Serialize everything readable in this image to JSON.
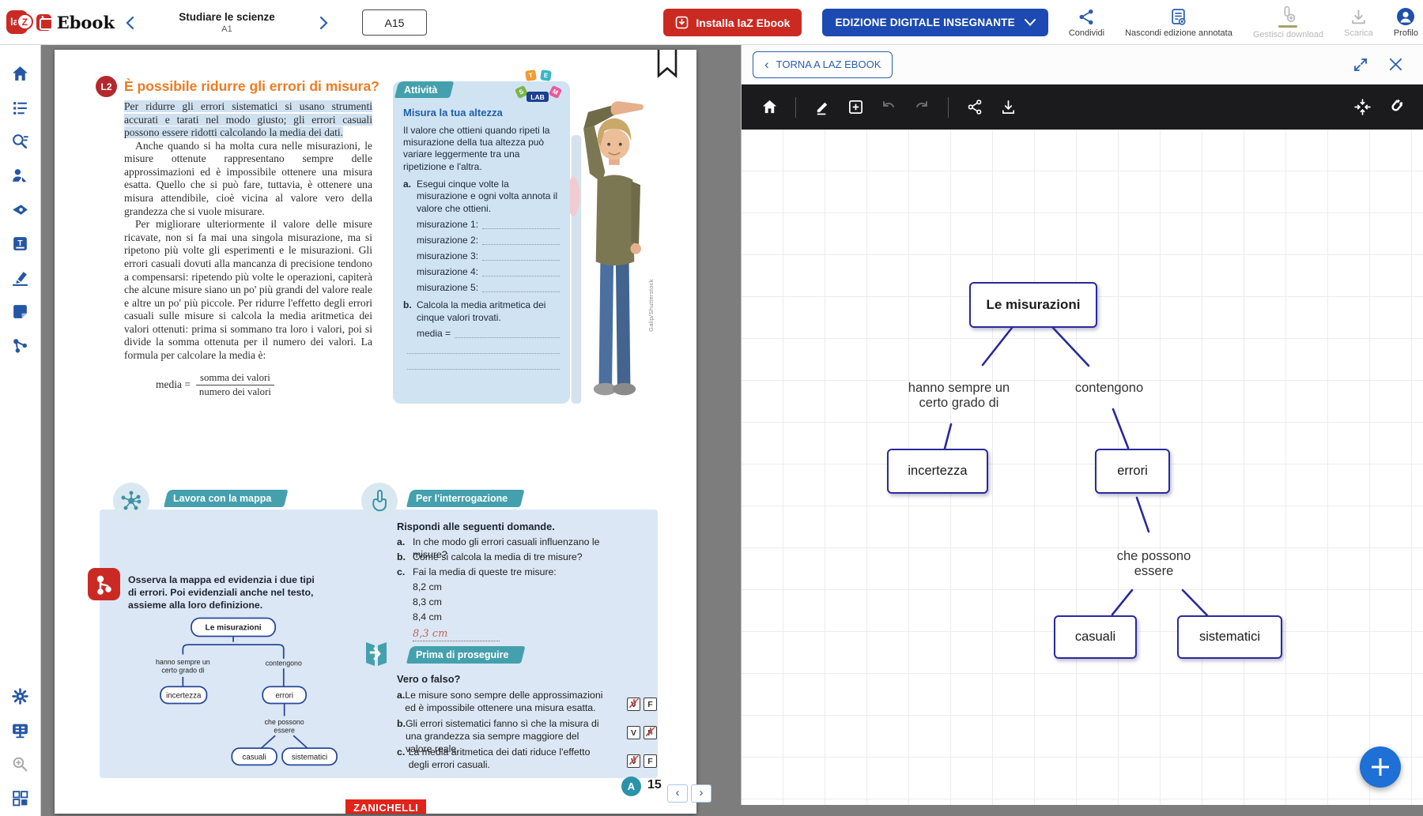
{
  "colors": {
    "brand_red": "#cb2a24",
    "primary_blue": "#1c4ab2",
    "icon_blue": "#2a5db0",
    "teal": "#45a0ae",
    "orange_heading": "#ee7b21",
    "panel_bg": "#dbe7f4",
    "activity_bg": "#cfe3f2",
    "map_indigo": "#2a2a9b",
    "fab_blue": "#1e6fd6",
    "zanichelli_red": "#e2231a",
    "highlight": "#cfe0ef"
  },
  "icons": {
    "nav_prev": "‹",
    "nav_next": "›",
    "back_chevron": "‹"
  },
  "topbar": {
    "logo_la": "la",
    "logo_z": "Z",
    "brand": "Ebook",
    "book_title": "Studiare le scienze",
    "book_code": "A1",
    "page_box": "A15",
    "install_label": "Installa laZ Ebook",
    "edition_label": "EDIZIONE DIGITALE INSEGNANTE",
    "actions": [
      {
        "label": "Condividi"
      },
      {
        "label": "Nascondi edizione annotata"
      },
      {
        "label": "Gestisci download"
      },
      {
        "label": "Scarica"
      },
      {
        "label": "Profilo"
      }
    ]
  },
  "page": {
    "lesson_badge": "L2",
    "heading": "È possibile ridurre gli errori di misura?",
    "para_highlight": "Per ridurre gli errori sistematici si usano strumenti accurati e tarati nel modo giusto; gli errori casuali possono essere ridotti calcolando la media dei dati.",
    "para2": "Anche quando si ha molta cura nelle misurazioni, le misure ottenute rappresentano sempre delle approssimazioni ed è impossibile ottenere una misura esatta. Quello che si può fare, tuttavia, è ottenere una misura attendibile, cioè vicina al valore vero della grandezza che si vuole misurare.",
    "para3": "Per migliorare ulteriormente il valore delle misure ricavate, non si fa mai una singola misurazione, ma si ripetono più volte gli esperimenti e le misurazioni. Gli errori casuali dovuti alla mancanza di precisione tendono a compensarsi: ripetendo più volte le operazioni, capiterà che alcune misure siano un po' più grandi del valore reale e altre un po' più piccole. Per ridurre l'effetto degli errori casuali sulle misure si calcola la media aritmetica dei valori ottenuti: prima si sommano tra loro i valori, poi si divide la somma ottenuta per il numero dei valori. La formula per calcolare la media è:",
    "formula": {
      "lhs": "media =",
      "num": "somma dei valori",
      "den": "numero dei valori"
    },
    "attivita": {
      "tab": "Attività",
      "stem_letters": [
        "S",
        "T",
        "E",
        "M"
      ],
      "stem_lab": "LAB",
      "title": "Misura la tua altezza",
      "intro": "Il valore che ottieni quando ripeti la misurazione della tua altezza può variare leggermente tra una ripetizione e l'altra.",
      "a_marker": "a.",
      "item_a": "Esegui cinque volte la misurazione e ogni volta annota il valore che ottieni.",
      "measurements": [
        "misurazione 1:",
        "misurazione 2:",
        "misurazione 3:",
        "misurazione 4:",
        "misurazione 5:"
      ],
      "b_marker": "b.",
      "item_b": "Calcola la media aritmetica dei cinque valori trovati.",
      "media_label": "media ="
    },
    "photo_credit": "Galip/Shutterstock",
    "mappa": {
      "tab": "Lavora con la mappa",
      "instruction": "Osserva la mappa ed evidenzia i due tipi di errori. Poi evidenziali anche nel testo, assieme alla loro definizione."
    },
    "interrogazione": {
      "tab": "Per l'interrogazione",
      "title": "Rispondi alle seguenti domande.",
      "items": [
        {
          "marker": "a.",
          "text": "In che modo gli errori casuali influenzano le misure?"
        },
        {
          "marker": "b.",
          "text": "Come si calcola la media di tre misure?"
        },
        {
          "marker": "c.",
          "text": "Fai la media di queste tre misure:"
        }
      ],
      "measures": [
        "8,2 cm",
        "8,3 cm",
        "8,4 cm"
      ],
      "handwritten_answer": "8,3 cm"
    },
    "proseguire": {
      "tab": "Prima di proseguire",
      "title": "Vero o falso?",
      "v_label": "V",
      "f_label": "F",
      "items": [
        {
          "marker": "a.",
          "text": "Le misure sono sempre delle approssimazioni ed è impossibile ottenere una misura esatta.",
          "v_mark": "✗",
          "f_mark": ""
        },
        {
          "marker": "b.",
          "text": "Gli errori sistematici fanno sì che la misura di una grandezza sia sempre maggiore del valore reale.",
          "v_mark": "",
          "f_mark": "✗"
        },
        {
          "marker": "c.",
          "text": "La media aritmetica dei dati riduce l'effetto degli errori casuali.",
          "v_mark": "✗",
          "f_mark": ""
        }
      ]
    },
    "footer": {
      "audio_badge": "A",
      "page_number": "15",
      "publisher": "ZANICHELLI"
    }
  },
  "panel": {
    "back_label": "TORNA A LAZ EBOOK"
  },
  "concept_map": {
    "root": "Le misurazioni",
    "edge_left": "hanno sempre un\ncerto grado di",
    "edge_left_1": "hanno sempre un",
    "edge_left_2": "certo grado di",
    "edge_right": "contengono",
    "node_left": "incertezza",
    "node_right": "errori",
    "edge_bottom": "che possono\nessere",
    "edge_bottom_1": "che possono",
    "edge_bottom_2": "essere",
    "leaf_left": "casuali",
    "leaf_right": "sistematici"
  }
}
